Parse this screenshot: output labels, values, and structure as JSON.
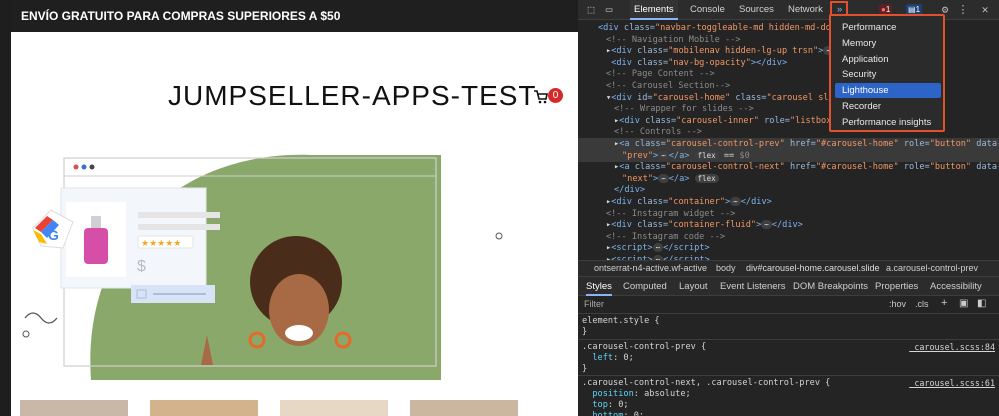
{
  "site": {
    "promo": "ENVÍO GRATUITO PARA COMPRAS SUPERIORES A $50",
    "store_title": "JUMPSELLER-APPS-TEST",
    "cart_count": "0",
    "product_price_symbol": "$"
  },
  "devtools": {
    "tabs": [
      "Elements",
      "Console",
      "Sources",
      "Network"
    ],
    "more_tabs": "»",
    "error_count": "1",
    "message_count": "1",
    "dom_lines": [
      {
        "indent": 0,
        "html": "<span class='tag'>&lt;div</span> <span class='attr'>class=</span><span class='val'>\"navbar-toggleable-md hidden-md-down\"</span>"
      },
      {
        "indent": 1,
        "html": "<span class='cm'>&lt;!-- Navigation Mobile --&gt;</span>"
      },
      {
        "indent": 1,
        "html": "▸<span class='tag'>&lt;div</span> <span class='attr'>class=</span><span class='val'>\"mobilenav hidden-lg-up trsn\"</span><span class='tag'>&gt;</span><span class='pill'>⋯</span><span class='tag'>&lt;/div&gt;</span>"
      },
      {
        "indent": 1,
        "html": "&nbsp;<span class='tag'>&lt;div</span> <span class='attr'>class=</span><span class='val'>\"nav-bg-opacity\"</span><span class='tag'>&gt;&lt;/div&gt;</span>"
      },
      {
        "indent": 1,
        "html": "<span class='cm'>&lt;!-- Page Content --&gt;</span>"
      },
      {
        "indent": 1,
        "html": "<span class='cm'>&lt;!-- Carousel Section--&gt;</span>"
      },
      {
        "indent": 1,
        "html": "▾<span class='tag'>&lt;div</span> <span class='attr'>id=</span><span class='val'>\"carousel-home\"</span> <span class='attr'>class=</span><span class='val'>\"carousel slide\"</span> <span class='attr'>data-ride=</span>"
      },
      {
        "indent": 2,
        "html": "<span class='cm'>&lt;!-- Wrapper for slides --&gt;</span>"
      },
      {
        "indent": 2,
        "html": "▸<span class='tag'>&lt;div</span> <span class='attr'>class=</span><span class='val'>\"carousel-inner\"</span> <span class='attr'>role=</span><span class='val'>\"listbox\"</span><span class='tag'>&gt;</span><span class='pill'>⋯</span>"
      },
      {
        "indent": 2,
        "html": "<span class='cm'>&lt;!-- Controls --&gt;</span>"
      },
      {
        "indent": 2,
        "html": "▸<span class='tag'>&lt;a</span> <span class='attr'>class=</span><span class='val'>\"carousel-control-prev\"</span> <span class='attr'>href=</span><span class='val'>\"#carousel-home\"</span> <span class='attr'>role=</span><span class='val'>\"button\"</span> <span class='attr'>data-slide=</span>"
      },
      {
        "indent": 3,
        "html": "<span class='val'>\"prev\"</span><span class='tag'>&gt;</span><span class='pill'>⋯</span><span class='tag'>&lt;/a&gt;</span> <span class='pill'>flex</span> == <span class='cm'>$0</span>"
      },
      {
        "indent": 2,
        "html": "▸<span class='tag'>&lt;a</span> <span class='attr'>class=</span><span class='val'>\"carousel-control-next\"</span> <span class='attr'>href=</span><span class='val'>\"#carousel-home\"</span> <span class='attr'>role=</span><span class='val'>\"button\"</span> <span class='attr'>data-slide=</span>"
      },
      {
        "indent": 3,
        "html": "<span class='val'>\"next\"</span><span class='tag'>&gt;</span><span class='pill'>⋯</span><span class='tag'>&lt;/a&gt;</span> <span class='pill'>flex</span>"
      },
      {
        "indent": 2,
        "html": "<span class='tag'>&lt;/div&gt;</span>"
      },
      {
        "indent": 1,
        "html": "▸<span class='tag'>&lt;div</span> <span class='attr'>class=</span><span class='val'>\"container\"</span><span class='tag'>&gt;</span><span class='pill'>⋯</span><span class='tag'>&lt;/div&gt;</span>"
      },
      {
        "indent": 1,
        "html": "<span class='cm'>&lt;!-- Instagram widget --&gt;</span>"
      },
      {
        "indent": 1,
        "html": "▸<span class='tag'>&lt;div</span> <span class='attr'>class=</span><span class='val'>\"container-fluid\"</span><span class='tag'>&gt;</span><span class='pill'>⋯</span><span class='tag'>&lt;/div&gt;</span>"
      },
      {
        "indent": 1,
        "html": "<span class='cm'>&lt;!-- Instagram code --&gt;</span>"
      },
      {
        "indent": 1,
        "html": "▸<span class='tag'>&lt;script&gt;</span><span class='pill'>⋯</span><span class='tag'>&lt;/script&gt;</span>"
      },
      {
        "indent": 1,
        "html": "▸<span class='tag'>&lt;script&gt;</span><span class='pill'>⋯</span><span class='tag'>&lt;/script&gt;</span>"
      }
    ],
    "breadcrumbs": [
      "ontserrat-n4-active.wf-active",
      "body",
      "div#carousel-home.carousel.slide",
      "a.carousel-control-prev"
    ],
    "sub_tabs": [
      "Styles",
      "Computed",
      "Layout",
      "Event Listeners",
      "DOM Breakpoints",
      "Properties",
      "Accessibility"
    ],
    "filter_placeholder": "Filter",
    "filter_hov": ":hov",
    "filter_cls": ".cls",
    "filter_plus": "+",
    "style_lines": [
      {
        "html": "element.style {",
        "src": ""
      },
      {
        "html": "}",
        "src": ""
      },
      {
        "html": ".carousel-control-prev {",
        "src": "_carousel.scss:84"
      },
      {
        "html": "&nbsp;&nbsp;<span class='prop'>left</span>: 0;",
        "src": ""
      },
      {
        "html": "}",
        "src": ""
      },
      {
        "html": ".carousel-control-next, .carousel-control-prev {",
        "src": "_carousel.scss:61"
      },
      {
        "html": "&nbsp;&nbsp;<span class='prop'>position</span>: absolute;",
        "src": ""
      },
      {
        "html": "&nbsp;&nbsp;<span class='prop'>top</span>: 0;",
        "src": ""
      },
      {
        "html": "&nbsp;&nbsp;<span class='prop'>bottom</span>: 0;",
        "src": ""
      }
    ],
    "more_menu": {
      "items": [
        "Performance",
        "Memory",
        "Application",
        "Security",
        "Lighthouse",
        "Recorder",
        "Performance insights"
      ],
      "highlighted": "Lighthouse"
    }
  }
}
